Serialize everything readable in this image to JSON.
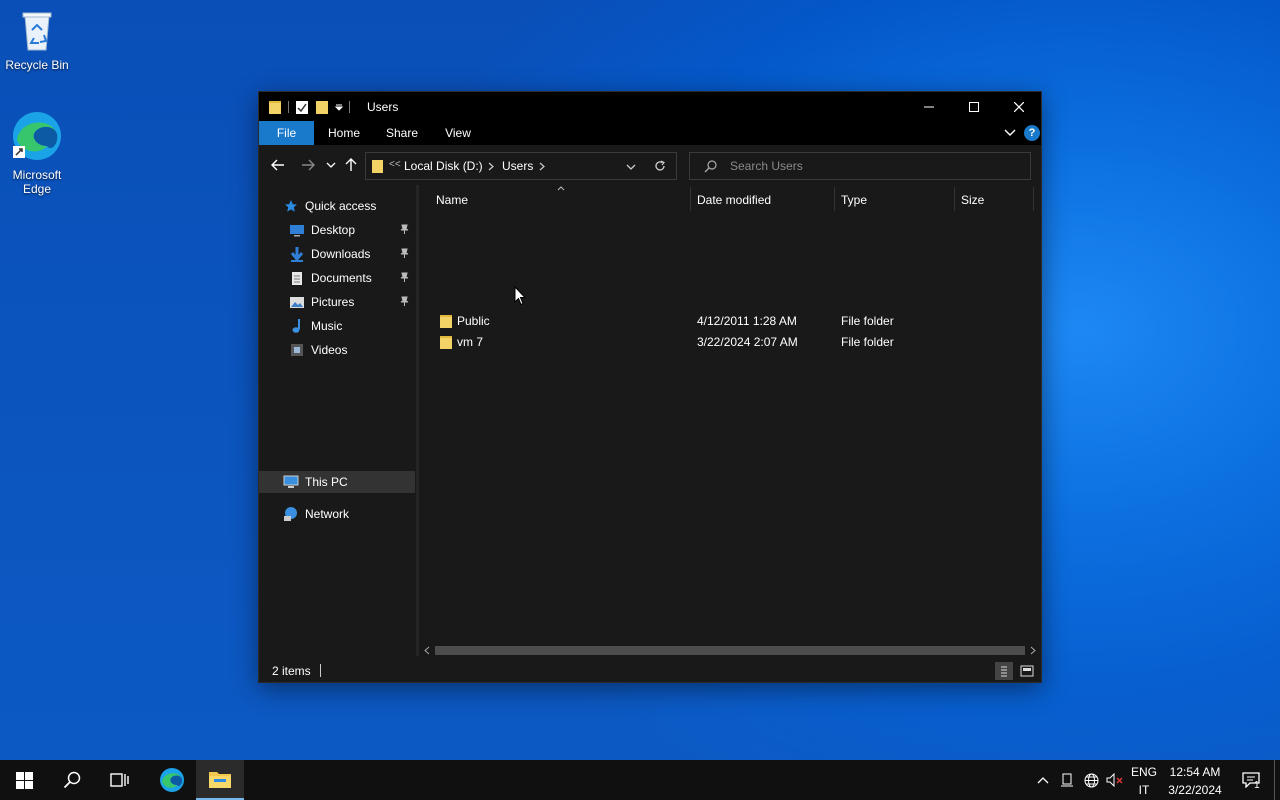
{
  "desktop": {
    "recycle_bin_label": "Recycle Bin",
    "edge_label_line1": "Microsoft",
    "edge_label_line2": "Edge"
  },
  "window": {
    "title": "Users",
    "ribbon_tabs": [
      "File",
      "Home",
      "Share",
      "View"
    ],
    "address": {
      "overflow": "<<",
      "segments": [
        "Local Disk (D:)",
        "Users"
      ]
    },
    "search_placeholder": "Search Users",
    "nav": {
      "quick_access": "Quick access",
      "items": [
        {
          "label": "Desktop",
          "icon": "desktop-icon",
          "pinned": true
        },
        {
          "label": "Downloads",
          "icon": "downloads-icon",
          "pinned": true
        },
        {
          "label": "Documents",
          "icon": "documents-icon",
          "pinned": true
        },
        {
          "label": "Pictures",
          "icon": "pictures-icon",
          "pinned": true
        },
        {
          "label": "Music",
          "icon": "music-icon",
          "pinned": false
        },
        {
          "label": "Videos",
          "icon": "videos-icon",
          "pinned": false
        }
      ],
      "this_pc": "This PC",
      "network": "Network"
    },
    "columns": [
      "Name",
      "Date modified",
      "Type",
      "Size"
    ],
    "files": [
      {
        "name": "Public",
        "date": "4/12/2011 1:28 AM",
        "type": "File folder",
        "size": ""
      },
      {
        "name": "vm 7",
        "date": "3/22/2024 2:07 AM",
        "type": "File folder",
        "size": ""
      }
    ],
    "status": "2 items"
  },
  "taskbar": {
    "lang_top": "ENG",
    "lang_bottom": "IT",
    "time": "12:54 AM",
    "date": "3/22/2024",
    "notification_count": "1"
  },
  "colors": {
    "accent": "#1979ca",
    "folder": "#f3d266",
    "window_bg": "#191919",
    "titlebar": "#000000"
  }
}
